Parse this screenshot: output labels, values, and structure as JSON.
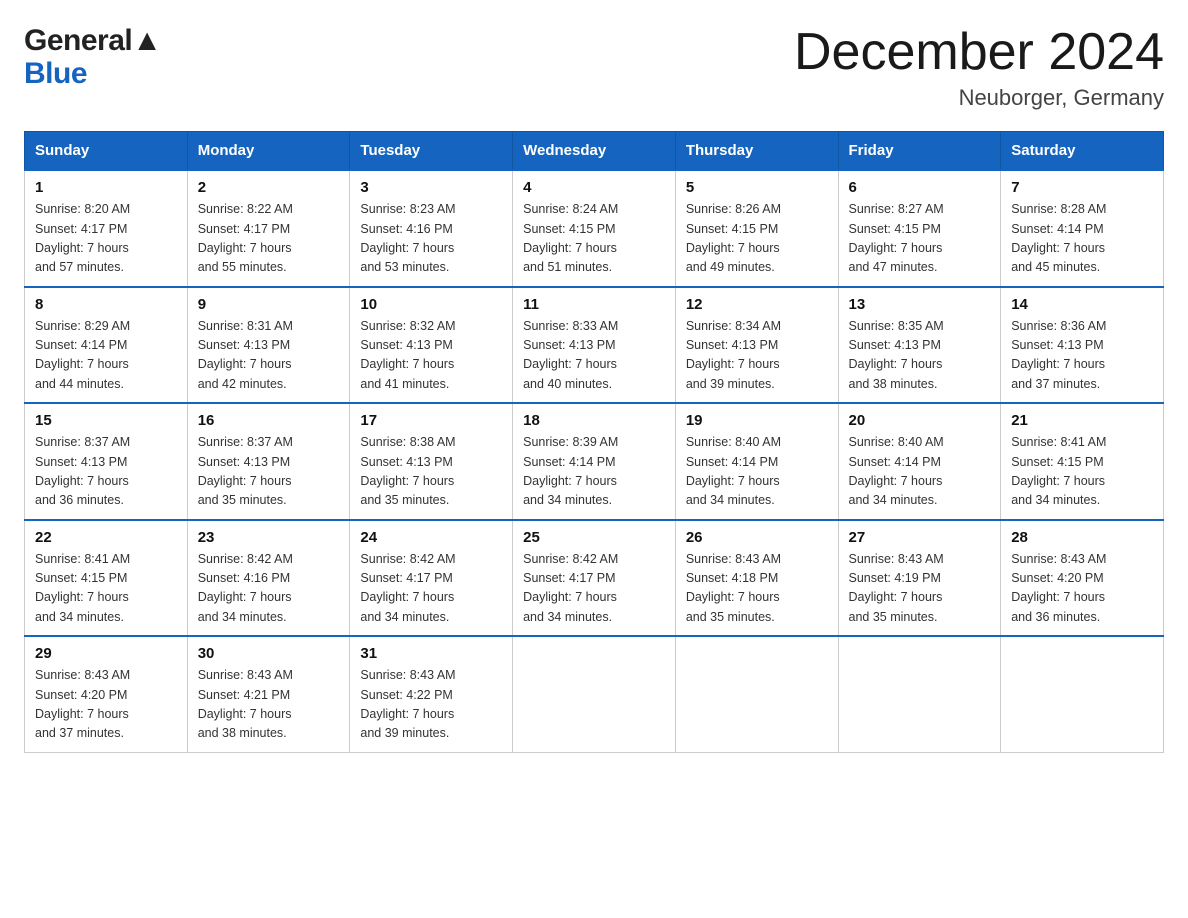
{
  "header": {
    "logo_line1": "General",
    "logo_line2": "Blue",
    "main_title": "December 2024",
    "subtitle": "Neuborger, Germany"
  },
  "days_of_week": [
    "Sunday",
    "Monday",
    "Tuesday",
    "Wednesday",
    "Thursday",
    "Friday",
    "Saturday"
  ],
  "weeks": [
    [
      {
        "day": "1",
        "sunrise": "8:20 AM",
        "sunset": "4:17 PM",
        "daylight": "7 hours and 57 minutes."
      },
      {
        "day": "2",
        "sunrise": "8:22 AM",
        "sunset": "4:17 PM",
        "daylight": "7 hours and 55 minutes."
      },
      {
        "day": "3",
        "sunrise": "8:23 AM",
        "sunset": "4:16 PM",
        "daylight": "7 hours and 53 minutes."
      },
      {
        "day": "4",
        "sunrise": "8:24 AM",
        "sunset": "4:15 PM",
        "daylight": "7 hours and 51 minutes."
      },
      {
        "day": "5",
        "sunrise": "8:26 AM",
        "sunset": "4:15 PM",
        "daylight": "7 hours and 49 minutes."
      },
      {
        "day": "6",
        "sunrise": "8:27 AM",
        "sunset": "4:15 PM",
        "daylight": "7 hours and 47 minutes."
      },
      {
        "day": "7",
        "sunrise": "8:28 AM",
        "sunset": "4:14 PM",
        "daylight": "7 hours and 45 minutes."
      }
    ],
    [
      {
        "day": "8",
        "sunrise": "8:29 AM",
        "sunset": "4:14 PM",
        "daylight": "7 hours and 44 minutes."
      },
      {
        "day": "9",
        "sunrise": "8:31 AM",
        "sunset": "4:13 PM",
        "daylight": "7 hours and 42 minutes."
      },
      {
        "day": "10",
        "sunrise": "8:32 AM",
        "sunset": "4:13 PM",
        "daylight": "7 hours and 41 minutes."
      },
      {
        "day": "11",
        "sunrise": "8:33 AM",
        "sunset": "4:13 PM",
        "daylight": "7 hours and 40 minutes."
      },
      {
        "day": "12",
        "sunrise": "8:34 AM",
        "sunset": "4:13 PM",
        "daylight": "7 hours and 39 minutes."
      },
      {
        "day": "13",
        "sunrise": "8:35 AM",
        "sunset": "4:13 PM",
        "daylight": "7 hours and 38 minutes."
      },
      {
        "day": "14",
        "sunrise": "8:36 AM",
        "sunset": "4:13 PM",
        "daylight": "7 hours and 37 minutes."
      }
    ],
    [
      {
        "day": "15",
        "sunrise": "8:37 AM",
        "sunset": "4:13 PM",
        "daylight": "7 hours and 36 minutes."
      },
      {
        "day": "16",
        "sunrise": "8:37 AM",
        "sunset": "4:13 PM",
        "daylight": "7 hours and 35 minutes."
      },
      {
        "day": "17",
        "sunrise": "8:38 AM",
        "sunset": "4:13 PM",
        "daylight": "7 hours and 35 minutes."
      },
      {
        "day": "18",
        "sunrise": "8:39 AM",
        "sunset": "4:14 PM",
        "daylight": "7 hours and 34 minutes."
      },
      {
        "day": "19",
        "sunrise": "8:40 AM",
        "sunset": "4:14 PM",
        "daylight": "7 hours and 34 minutes."
      },
      {
        "day": "20",
        "sunrise": "8:40 AM",
        "sunset": "4:14 PM",
        "daylight": "7 hours and 34 minutes."
      },
      {
        "day": "21",
        "sunrise": "8:41 AM",
        "sunset": "4:15 PM",
        "daylight": "7 hours and 34 minutes."
      }
    ],
    [
      {
        "day": "22",
        "sunrise": "8:41 AM",
        "sunset": "4:15 PM",
        "daylight": "7 hours and 34 minutes."
      },
      {
        "day": "23",
        "sunrise": "8:42 AM",
        "sunset": "4:16 PM",
        "daylight": "7 hours and 34 minutes."
      },
      {
        "day": "24",
        "sunrise": "8:42 AM",
        "sunset": "4:17 PM",
        "daylight": "7 hours and 34 minutes."
      },
      {
        "day": "25",
        "sunrise": "8:42 AM",
        "sunset": "4:17 PM",
        "daylight": "7 hours and 34 minutes."
      },
      {
        "day": "26",
        "sunrise": "8:43 AM",
        "sunset": "4:18 PM",
        "daylight": "7 hours and 35 minutes."
      },
      {
        "day": "27",
        "sunrise": "8:43 AM",
        "sunset": "4:19 PM",
        "daylight": "7 hours and 35 minutes."
      },
      {
        "day": "28",
        "sunrise": "8:43 AM",
        "sunset": "4:20 PM",
        "daylight": "7 hours and 36 minutes."
      }
    ],
    [
      {
        "day": "29",
        "sunrise": "8:43 AM",
        "sunset": "4:20 PM",
        "daylight": "7 hours and 37 minutes."
      },
      {
        "day": "30",
        "sunrise": "8:43 AM",
        "sunset": "4:21 PM",
        "daylight": "7 hours and 38 minutes."
      },
      {
        "day": "31",
        "sunrise": "8:43 AM",
        "sunset": "4:22 PM",
        "daylight": "7 hours and 39 minutes."
      },
      null,
      null,
      null,
      null
    ]
  ],
  "labels": {
    "sunrise": "Sunrise:",
    "sunset": "Sunset:",
    "daylight": "Daylight:"
  }
}
